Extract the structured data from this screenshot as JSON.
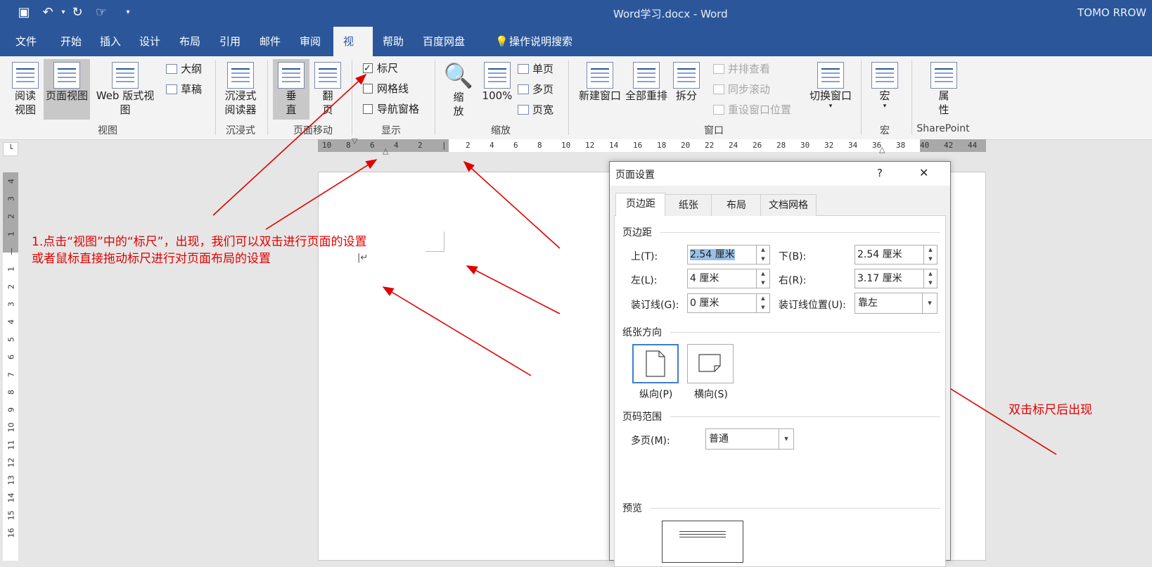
{
  "window": {
    "title": "Word学习.docx  -  Word",
    "user": "TOMO RROW"
  },
  "menu": {
    "tabs": [
      "文件",
      "开始",
      "插入",
      "设计",
      "布局",
      "引用",
      "邮件",
      "审阅",
      "视图",
      "帮助",
      "百度网盘"
    ],
    "active": "视图",
    "tellme": "操作说明搜索"
  },
  "ribbon": {
    "view": {
      "read": "阅读\n视图",
      "print": "页面视图",
      "web": "Web 版式视图",
      "outline": "大纲",
      "draft": "草稿",
      "group": "视图"
    },
    "immersive": {
      "reader": "沉浸式\n阅读器",
      "group": "沉浸式"
    },
    "pagemove": {
      "vertical": "垂\n直",
      "flip": "翻\n页",
      "group": "页面移动"
    },
    "show": {
      "ruler": "标尺",
      "gridlines": "网格线",
      "nav": "导航窗格",
      "ruler_checked": true,
      "group": "显示"
    },
    "zoom": {
      "zoom": "缩\n放",
      "pct": "100%",
      "one": "单页",
      "multi": "多页",
      "width": "页宽",
      "group": "缩放"
    },
    "window": {
      "newwin": "新建窗口",
      "arrange": "全部重排",
      "split": "拆分",
      "side": "并排查看",
      "sync": "同步滚动",
      "reset": "重设窗口位置",
      "switch": "切换窗口",
      "group": "窗口"
    },
    "macro": {
      "macro": "宏",
      "group": "宏"
    },
    "sp": {
      "props": "属\n性",
      "group": "SharePoint"
    }
  },
  "ruler": {
    "h_labels": [
      "10",
      "8",
      "6",
      "4",
      "2",
      "",
      "2",
      "4",
      "6",
      "8",
      "10",
      "12",
      "14",
      "16",
      "18",
      "20",
      "22",
      "24",
      "26",
      "28",
      "30",
      "32",
      "34",
      "36",
      "38",
      "40",
      "42",
      "44"
    ],
    "v_labels": [
      "4",
      "3",
      "2",
      "1",
      "",
      "1",
      "2",
      "3",
      "4",
      "5",
      "6",
      "7",
      "8",
      "9",
      "10",
      "11",
      "12",
      "13",
      "14",
      "15",
      "16"
    ]
  },
  "dialog": {
    "title": "页面设置",
    "help": "?",
    "close": "✕",
    "tabs": [
      "页边距",
      "纸张",
      "布局",
      "文档网格"
    ],
    "margins_label": "页边距",
    "top_label": "上(T):",
    "top_val": "2.54 厘米",
    "bottom_label": "下(B):",
    "bottom_val": "2.54 厘米",
    "left_label": "左(L):",
    "left_val": "4 厘米",
    "right_label": "右(R):",
    "right_val": "3.17 厘米",
    "gutter_label": "装订线(G):",
    "gutter_val": "0 厘米",
    "gutter_pos_label": "装订线位置(U):",
    "gutter_pos_val": "靠左",
    "orient_label": "纸张方向",
    "portrait": "纵向(P)",
    "landscape": "横向(S)",
    "pages_label": "页码范围",
    "multi_label": "多页(M):",
    "multi_val": "普通",
    "preview_label": "预览"
  },
  "annotations": {
    "note1_line1": "1.点击“视图”中的“标尺”，出现，我们可以双击进行页面的设置",
    "note1_line2": "或者鼠标直接拖动标尺进行对页面布局的设置",
    "note2": "双击标尺后出现",
    "color": "#e00000"
  }
}
